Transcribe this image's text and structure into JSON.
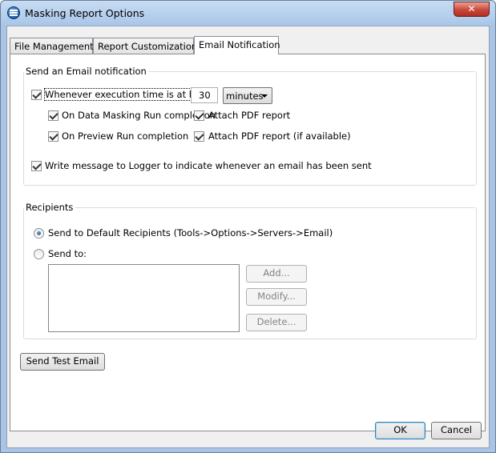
{
  "window": {
    "title": "Masking Report Options",
    "close_glyph": "✕"
  },
  "tabs": [
    "File Management",
    "Report Customization",
    "Email Notification"
  ],
  "active_tab": "Email Notification",
  "email_group": {
    "legend": "Send an Email notification",
    "exec_time": {
      "label": "Whenever execution time is at least",
      "checked": true,
      "value": "30",
      "unit": "minutes"
    },
    "data_masking": {
      "label": "On Data Masking Run completion",
      "checked": true
    },
    "attach_pdf": {
      "label": "Attach PDF report",
      "checked": true
    },
    "preview_run": {
      "label": "On Preview Run completion",
      "checked": true
    },
    "attach_pdf_available": {
      "label": "Attach PDF report (if available)",
      "checked": true
    },
    "logger": {
      "label": "Write message to Logger to indicate whenever an email has been sent",
      "checked": true
    }
  },
  "recipients_group": {
    "legend": "Recipients",
    "default_radio": {
      "label": "Send to Default Recipients  (Tools->Options->Servers->Email)",
      "selected": true
    },
    "send_to_radio": {
      "label": "Send to:",
      "selected": false
    },
    "recipients_list": [],
    "add_label": "Add...",
    "modify_label": "Modify...",
    "delete_label": "Delete..."
  },
  "send_test_email_label": "Send Test Email",
  "ok_label": "OK",
  "cancel_label": "Cancel"
}
